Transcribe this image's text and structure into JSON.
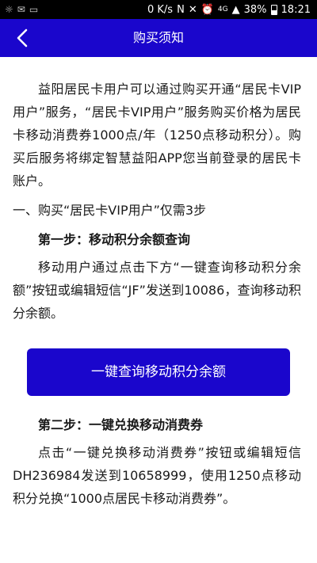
{
  "statusbar": {
    "network_speed": "0 K/s",
    "signal_label": "4G",
    "battery": "38%",
    "time": "18:21"
  },
  "navbar": {
    "title": "购买须知"
  },
  "content": {
    "intro": "益阳居民卡用户可以通过购买开通“居民卡VIP用户”服务，“居民卡VIP用户”服务购买价格为居民卡移动消费券1000点/年（1250点移动积分）。购买后服务将绑定智慧益阳APP您当前登录的居民卡账户。",
    "section1": "一、购买“居民卡VIP用户”仅需3步",
    "step1_title": "第一步：移动积分余额查询",
    "step1_text": "移动用户通过点击下方“一键查询移动积分余额”按钮或编辑短信“JF”发送到10086，查询移动积分余额。",
    "query_button": "一键查询移动积分余额",
    "step2_title": "第二步：一键兑换移动消费券",
    "step2_text": "点击“一键兑换移动消费券”按钮或编辑短信DH236984发送到10658999，使用1250点移动积分兑换“1000点居民卡移动消费券”。"
  },
  "colors": {
    "accent": "#1a06cc",
    "statusbar": "#000000",
    "text": "#1a1a1a"
  },
  "icons": {
    "back": "chevron-left-icon"
  }
}
